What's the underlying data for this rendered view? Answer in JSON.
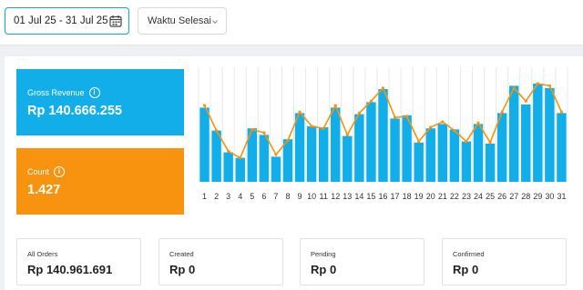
{
  "filters": {
    "date_range": "01 Jul 25 - 31 Jul 25",
    "date_icon": "calendar-icon",
    "sort_label": "Waktu Selesai",
    "sort_icon": "chevron-down-icon"
  },
  "cards": {
    "revenue": {
      "label": "Gross Revenue",
      "value": "Rp 140.666.255",
      "icon": "info-icon",
      "color": "#12aee9"
    },
    "count": {
      "label": "Count",
      "value": "1.427",
      "icon": "info-icon",
      "color": "#f7930e"
    }
  },
  "stats": [
    {
      "label": "All Orders",
      "value": "Rp 140.961.691"
    },
    {
      "label": "Created",
      "value": "Rp 0"
    },
    {
      "label": "Pending",
      "value": "Rp 0"
    },
    {
      "label": "Confirmed",
      "value": "Rp 0"
    }
  ],
  "chart_data": {
    "type": "bar",
    "categories": [
      "1",
      "2",
      "3",
      "4",
      "5",
      "6",
      "7",
      "8",
      "9",
      "10",
      "11",
      "12",
      "13",
      "14",
      "15",
      "16",
      "17",
      "18",
      "19",
      "20",
      "21",
      "22",
      "23",
      "24",
      "25",
      "26",
      "27",
      "28",
      "29",
      "30",
      "31"
    ],
    "series": [
      {
        "values": [
          68,
          47,
          27,
          22,
          49,
          43,
          23,
          39,
          63,
          51,
          50,
          68,
          42,
          62,
          73,
          85,
          58,
          61,
          36,
          49,
          53,
          48,
          37,
          53,
          35,
          63,
          88,
          71,
          90,
          86,
          63
        ],
        "color": "#12aee9"
      },
      {
        "values": [
          70,
          47,
          28,
          22,
          48,
          45,
          25,
          38,
          64,
          51,
          49,
          70,
          43,
          63,
          74,
          86,
          59,
          60,
          37,
          50,
          55,
          47,
          37,
          54,
          36,
          64,
          86,
          74,
          90,
          88,
          64
        ],
        "color": "#f7930e"
      }
    ],
    "ylim": [
      0,
      100
    ],
    "grid": true
  }
}
